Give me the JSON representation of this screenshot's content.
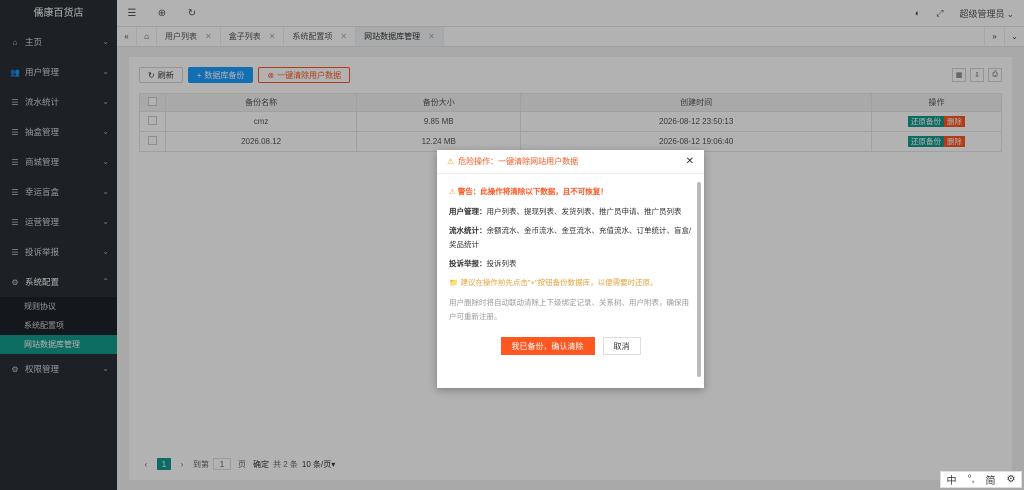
{
  "app": {
    "title": "儒康百货店"
  },
  "sidebar": {
    "items": [
      {
        "label": "主页",
        "icon": "home-icon",
        "glyph": "⌂"
      },
      {
        "label": "用户管理",
        "icon": "users-icon",
        "glyph": "👥"
      },
      {
        "label": "流水统计",
        "icon": "list-icon",
        "glyph": "☰"
      },
      {
        "label": "抽盒管理",
        "icon": "list-icon",
        "glyph": "☰"
      },
      {
        "label": "商城管理",
        "icon": "list-icon",
        "glyph": "☰"
      },
      {
        "label": "幸运盲盒",
        "icon": "list-icon",
        "glyph": "☰"
      },
      {
        "label": "运营管理",
        "icon": "list-icon",
        "glyph": "☰"
      },
      {
        "label": "投诉举报",
        "icon": "list-icon",
        "glyph": "☰"
      },
      {
        "label": "系统配置",
        "icon": "settings-icon",
        "glyph": "⚙"
      }
    ],
    "sub_items": [
      "规则协议",
      "系统配置项",
      "网站数据库管理"
    ],
    "last_item": {
      "label": "权限管理",
      "icon": "gear-icon",
      "glyph": "⚙"
    }
  },
  "topbar": {
    "user": "超级管理员",
    "icons": [
      "menu-fold-icon",
      "globe-icon",
      "refresh-icon",
      "theme-icon",
      "fullscreen-icon"
    ]
  },
  "tabs": [
    {
      "label": "用户列表"
    },
    {
      "label": "盒子列表"
    },
    {
      "label": "系统配置项"
    },
    {
      "label": "网站数据库管理",
      "active": true
    }
  ],
  "toolbar": {
    "refresh": "刷新",
    "backup": "数据库备份",
    "clear": "一键清除用户数据"
  },
  "table": {
    "headers": [
      "备份名称",
      "备份大小",
      "创建时间",
      "操作"
    ],
    "rows": [
      {
        "name": "cmz",
        "size": "9.85 MB",
        "time": "2026-08-12 23:50:13"
      },
      {
        "name": "2026.08.12",
        "size": "12.24 MB",
        "time": "2026-08-12 19:06:40"
      }
    ],
    "op_restore": "还原备份",
    "op_delete": "删除"
  },
  "pager": {
    "current": "1",
    "goto": "到第",
    "page_input": "1",
    "page_unit": "页",
    "confirm": "确定",
    "total": "共 2 条",
    "per_page": "10 条/页"
  },
  "dialog": {
    "title": "危险操作：一键清除网站用户数据",
    "warning": "警告：此操作将清除以下数据，且不可恢复！",
    "sections": [
      {
        "label": "用户管理：",
        "text": "用户列表、提现列表、发货列表、推广员申请、推广员列表"
      },
      {
        "label": "流水统计：",
        "text": "余额流水、金币流水、金豆流水、充值流水、订单统计、盲盒/奖品统计"
      },
      {
        "label": "投诉举报：",
        "text": "投诉列表"
      }
    ],
    "hint": "建议在操作前先点击\"+\"按钮备份数据库，以便需要时还原。",
    "note": "用户删除时将自动联动清除上下级绑定记录、关系树、用户附表，确保用户可重新注册。",
    "confirm": "我已备份，确认清除",
    "cancel": "取消"
  },
  "ime": {
    "lang": "中",
    "punct": "°,",
    "mode": "简"
  }
}
